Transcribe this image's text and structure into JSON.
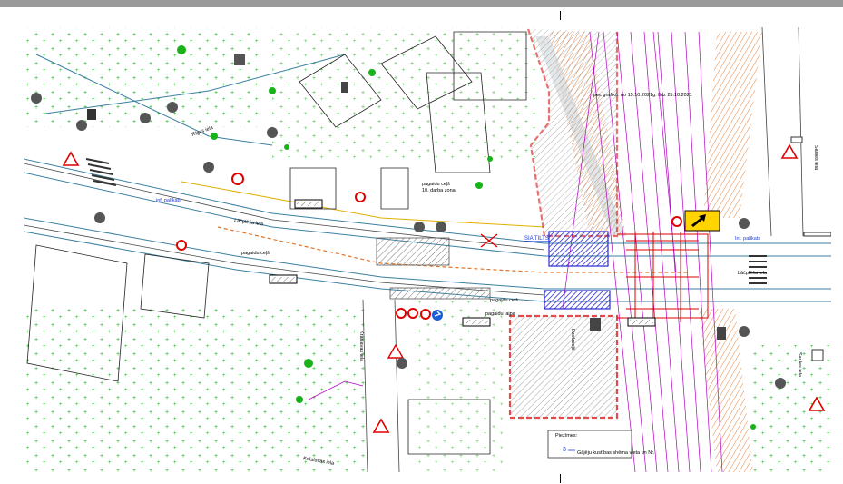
{
  "labels": {
    "street_main_left": "Lāčplēša iela",
    "street_main_right": "Lāčplēša iela",
    "street_upper_left": "Rīgas iela",
    "street_kr": "Krāslavas iela",
    "street_kr_side": "Krāslavas iela",
    "street_far_right": "Saules iela",
    "street_far_right2": "Saules iela",
    "ped_path_1": "pagaidu ceļš",
    "ped_path_2": "pagaidu ceļš",
    "work_zone": "pagaidu ceļš\n10. darba zona",
    "ped_bridge": "pagaidu laipa",
    "sia_tilts": "SIA TILTS",
    "info_board_1": "inf. palīkats",
    "info_board_2": "Inf. palīkats",
    "schedule": "pec grafikā: no 15.10.2021g. līdz 25.10.2021",
    "rail_label": "Dzelzceļš",
    "legend_title": "Piezīmes:",
    "legend_item": "Gājēju kustības shēma vieta un Nr.",
    "legend_num": "3"
  },
  "colors": {
    "hatch_red": "#d40000",
    "blue_zone": "#3b3bd6",
    "road_line": "#3a7fa0",
    "green_cross": "#19b319",
    "magenta_track": "#b000c0",
    "orange_slope": "#e0762a",
    "warning_yellow": "#ffd400"
  },
  "icons": [
    "no-entry-icon",
    "warning-triangle-icon",
    "detour-arrow-icon",
    "traffic-light-icon",
    "info-sign-icon"
  ]
}
